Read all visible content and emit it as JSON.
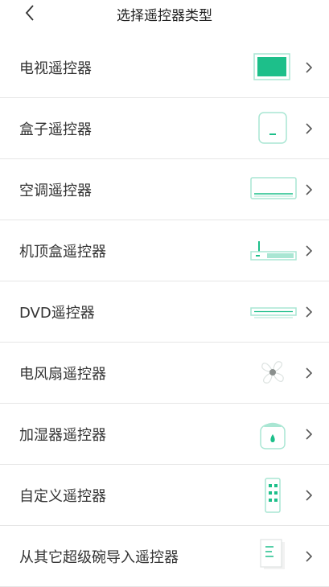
{
  "header": {
    "title": "选择遥控器类型"
  },
  "items": [
    {
      "label": "电视遥控器",
      "icon": "tv-icon"
    },
    {
      "label": "盒子遥控器",
      "icon": "box-icon"
    },
    {
      "label": "空调遥控器",
      "icon": "air-conditioner-icon"
    },
    {
      "label": "机顶盒遥控器",
      "icon": "set-top-box-icon"
    },
    {
      "label": "DVD遥控器",
      "icon": "dvd-player-icon"
    },
    {
      "label": "电风扇遥控器",
      "icon": "fan-icon"
    },
    {
      "label": "加湿器遥控器",
      "icon": "humidifier-icon"
    },
    {
      "label": "自定义遥控器",
      "icon": "custom-remote-icon"
    },
    {
      "label": "从其它超级碗导入遥控器",
      "icon": "import-document-icon"
    }
  ],
  "colors": {
    "accent": "#1dbf8a",
    "accent_light": "#a9e6d3",
    "chevron": "#555555"
  }
}
